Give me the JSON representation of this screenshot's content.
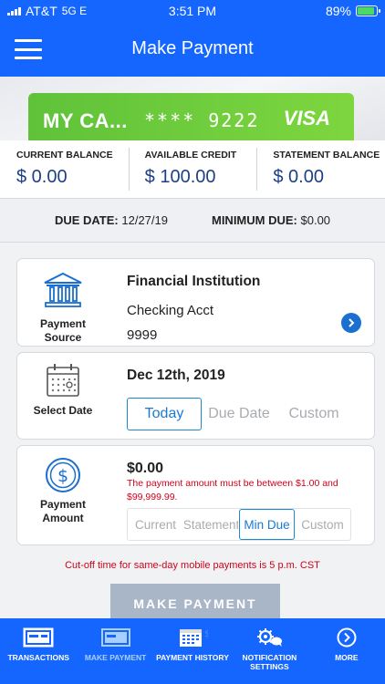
{
  "status_bar": {
    "carrier": "AT&T",
    "network": "5G E",
    "time": "3:51 PM",
    "battery": "89%"
  },
  "nav": {
    "title": "Make Payment"
  },
  "card": {
    "name": "MY CA...",
    "masked_number": "**** 9222",
    "brand": "VISA",
    "color": "#6fcc3c"
  },
  "balances": [
    {
      "label": "CURRENT BALANCE",
      "value": "$ 0.00"
    },
    {
      "label": "AVAILABLE CREDIT",
      "value": "$ 100.00"
    },
    {
      "label": "STATEMENT BALANCE",
      "value": "$ 0.00"
    }
  ],
  "due": {
    "date_label": "DUE DATE:",
    "date_value": "12/27/19",
    "min_label": "MINIMUM DUE:",
    "min_value": "$0.00"
  },
  "payment_source": {
    "label_line1": "Payment",
    "label_line2": "Source",
    "title": "Financial Institution",
    "account": "Checking Acct",
    "number": "9999"
  },
  "select_date": {
    "label": "Select Date",
    "date": "Dec 12th, 2019",
    "options": [
      "Today",
      "Due Date",
      "Custom"
    ],
    "selected": "Today"
  },
  "payment_amount": {
    "label_line1": "Payment",
    "label_line2": "Amount",
    "value": "$0.00",
    "message": "The payment amount must be between $1.00 and $99,999.99.",
    "options": [
      "Current",
      "Statement",
      "Min Due",
      "Custom"
    ],
    "selected": "Min Due"
  },
  "cutoff_text": "Cut-off time for same-day mobile payments is 5 p.m. CST",
  "make_payment_label": "MAKE PAYMENT",
  "tabs": [
    {
      "label": "TRANSACTIONS",
      "icon": "transactions-icon"
    },
    {
      "label": "MAKE PAYMENT",
      "icon": "make-payment-icon"
    },
    {
      "label": "PAYMENT HISTORY",
      "icon": "calendar-icon"
    },
    {
      "label": "NOTIFICATION SETTINGS",
      "icon": "gear-chat-icon"
    },
    {
      "label": "MORE",
      "icon": "more-icon"
    }
  ],
  "colors": {
    "brand_blue": "#1466ff",
    "error_red": "#d0021b",
    "accent": "#1a8ad0"
  }
}
